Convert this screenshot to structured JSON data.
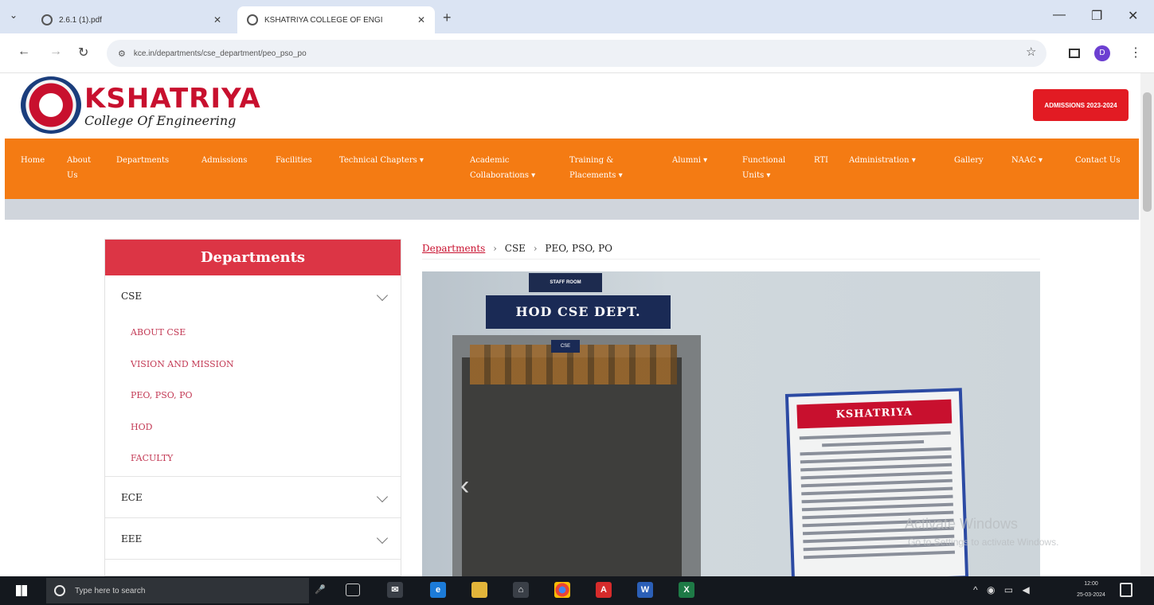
{
  "browser": {
    "tabs": [
      {
        "title": "2.6.1 (1).pdf"
      },
      {
        "title": "KSHATRIYA COLLEGE OF ENGI"
      }
    ],
    "url": "kce.in/departments/cse_department/peo_pso_po"
  },
  "site": {
    "name": "KSHATRIYA",
    "tagline": "College Of Engineering",
    "admissions_badge": "ADMISSIONS 2023-2024"
  },
  "nav": [
    {
      "label": "Home"
    },
    {
      "label": "About Us"
    },
    {
      "label": "Departments"
    },
    {
      "label": "Admissions"
    },
    {
      "label": "Facilities"
    },
    {
      "label": "Technical Chapters ▾"
    },
    {
      "label": "Academic Collaborations ▾"
    },
    {
      "label": "Training & Placements ▾"
    },
    {
      "label": "Alumni ▾"
    },
    {
      "label": "Functional Units ▾"
    },
    {
      "label": "RTI"
    },
    {
      "label": "Administration ▾"
    },
    {
      "label": "Gallery"
    },
    {
      "label": "NAAC ▾"
    },
    {
      "label": "Contact Us"
    }
  ],
  "sidebar": {
    "heading": "Departments",
    "departments": [
      {
        "name": "CSE",
        "expanded": true
      },
      {
        "name": "ECE",
        "expanded": false
      },
      {
        "name": "EEE",
        "expanded": false
      }
    ],
    "cse_links": [
      "ABOUT CSE",
      "VISION AND MISSION",
      "PEO, PSO, PO",
      "HOD",
      "FACULTY"
    ]
  },
  "breadcrumb": {
    "root": "Departments",
    "dept": "CSE",
    "page": "PEO, PSO, PO",
    "separator": "›"
  },
  "photo": {
    "staff_sign": "STAFF ROOM",
    "hod_sign": "HOD CSE DEPT.",
    "room_tag": "CSE",
    "notice_title": "KSHATRIYA"
  },
  "watermark": {
    "line1": "Activate Windows",
    "line2": "Go to Settings to activate Windows."
  },
  "taskbar": {
    "search_placeholder": "Type here to search",
    "time": "12:00",
    "date": "25-03-2024"
  },
  "colors": {
    "brand_red": "#c8102e",
    "nav_orange": "#f47b13",
    "sidebar_header": "#dc3545"
  }
}
